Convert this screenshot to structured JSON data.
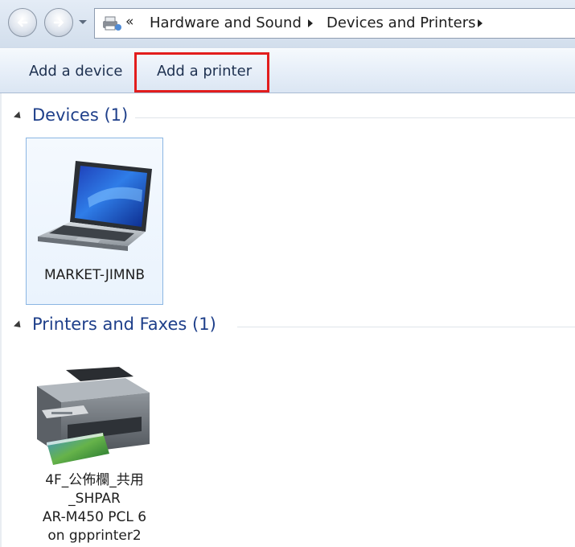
{
  "address_bar": {
    "overflow_chevron": "«",
    "breadcrumbs": [
      "Hardware and Sound",
      "Devices and Printers"
    ]
  },
  "toolbar": {
    "add_device_label": "Add a device",
    "add_printer_label": "Add a printer"
  },
  "groups": [
    {
      "title": "Devices",
      "count": "(1)",
      "items": [
        {
          "name": "MARKET-JIMNB",
          "icon": "laptop-icon"
        }
      ]
    },
    {
      "title": "Printers and Faxes",
      "count": "(1)",
      "items": [
        {
          "name_lines": [
            "4F_公佈欄_共用",
            "_SHPAR",
            "AR-M450 PCL 6",
            "on gpprinter2"
          ],
          "icon": "printer-icon"
        }
      ]
    }
  ],
  "colors": {
    "group_title": "#1e3f8a",
    "highlight_box": "#e21d1d",
    "selected_tile_border": "#8bb6e3"
  }
}
